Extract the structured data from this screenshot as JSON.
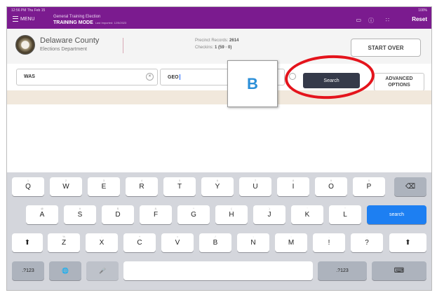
{
  "status_bar": {
    "time": "12:56 PM  Thu Feb 15",
    "battery": "100%"
  },
  "header": {
    "menu_label": "MENU",
    "election_name": "General Training Election",
    "mode": "TRAINING MODE",
    "last_imported": "Last Imported: 12/5/2023",
    "reset_label": "Reset",
    "bg_color": "#7b1b8f"
  },
  "county": {
    "name": "Delaware County",
    "department": "Elections Department",
    "precinct_label": "Precinct Records:",
    "precinct_value": "2614",
    "checkins_label": "Checkins:",
    "checkins_value": "1 (59 · 0)",
    "start_over_label": "START OVER"
  },
  "search": {
    "last_name_value": "WAS",
    "first_name_value": "GEO",
    "callout_label": "B",
    "search_label": "Search",
    "advanced_line1": "ADVANCED",
    "advanced_line2": "OPTIONS",
    "highlight_color": "#e4141c",
    "button_color": "#353a4a"
  },
  "keyboard": {
    "rows": [
      [
        {
          "label": "Q",
          "hint": "1"
        },
        {
          "label": "W",
          "hint": "2"
        },
        {
          "label": "E",
          "hint": "3"
        },
        {
          "label": "R",
          "hint": "4"
        },
        {
          "label": "T",
          "hint": "5"
        },
        {
          "label": "Y",
          "hint": "6"
        },
        {
          "label": "U",
          "hint": "7"
        },
        {
          "label": "I",
          "hint": "8"
        },
        {
          "label": "O",
          "hint": "9"
        },
        {
          "label": "P",
          "hint": "0"
        }
      ],
      [
        {
          "label": "A",
          "hint": "@"
        },
        {
          "label": "S",
          "hint": "#"
        },
        {
          "label": "D",
          "hint": "$"
        },
        {
          "label": "F",
          "hint": "&"
        },
        {
          "label": "G",
          "hint": "*"
        },
        {
          "label": "H",
          "hint": "("
        },
        {
          "label": "J",
          "hint": ")"
        },
        {
          "label": "K",
          "hint": "'"
        },
        {
          "label": "L",
          "hint": "\""
        }
      ],
      [
        {
          "label": "Z",
          "hint": "%"
        },
        {
          "label": "X",
          "hint": "-"
        },
        {
          "label": "C",
          "hint": "+"
        },
        {
          "label": "V",
          "hint": "="
        },
        {
          "label": "B",
          "hint": "/"
        },
        {
          "label": "N",
          "hint": ";"
        },
        {
          "label": "M",
          "hint": ":"
        },
        {
          "label": "!",
          "hint": ","
        },
        {
          "label": "?",
          "hint": "."
        }
      ]
    ],
    "delete_icon": "⌫",
    "shift_icon": "⬆",
    "search_key_label": "search",
    "numbers_label": ".?123",
    "globe_icon": "🌐",
    "dictation_icon": "🎤",
    "hide_keyboard_icon": "⌨"
  }
}
